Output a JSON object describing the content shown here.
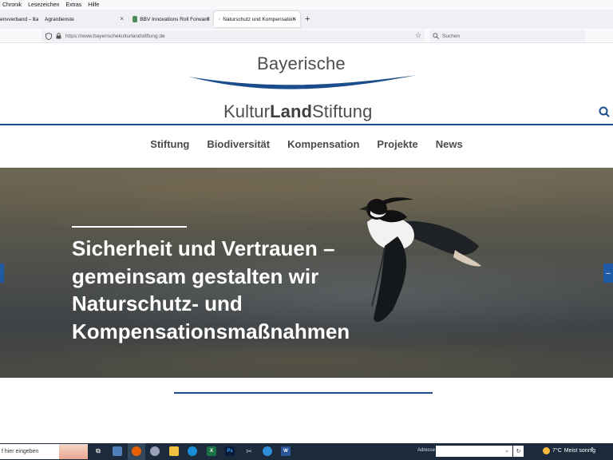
{
  "menubar": [
    "Chronik",
    "Lesezeichen",
    "Extras",
    "Hilfe"
  ],
  "tabs": [
    {
      "label": "envverband – La",
      "active": false
    },
    {
      "label": "Agrardienste",
      "active": false
    },
    {
      "label": "BBV Innovations Roll Forward",
      "active": false
    },
    {
      "label": "Naturschutz und Kompensation",
      "active": true
    }
  ],
  "navbar": {
    "url": "https://www.bayerischekulturlandstiftung.de",
    "search_placeholder": "Suchen"
  },
  "site": {
    "logo_top": "Bayerische",
    "logo_bottom_a": "Kultur",
    "logo_bottom_b": "Land",
    "logo_bottom_c": "Stiftung",
    "nav": [
      "Stiftung",
      "Biodiversität",
      "Kompensation",
      "Projekte",
      "News"
    ],
    "hero_title": "Sicherheit und Vertrauen – gemeinsam gestalten wir Naturschutz- und Kompensationsmaßnahmen",
    "accent_color": "#1b4d8c"
  },
  "taskbar": {
    "search_placeholder": "f hier eingeben",
    "address_label": "Adresse",
    "weather_temp": "7°C",
    "weather_text": "Meist sonnig"
  }
}
